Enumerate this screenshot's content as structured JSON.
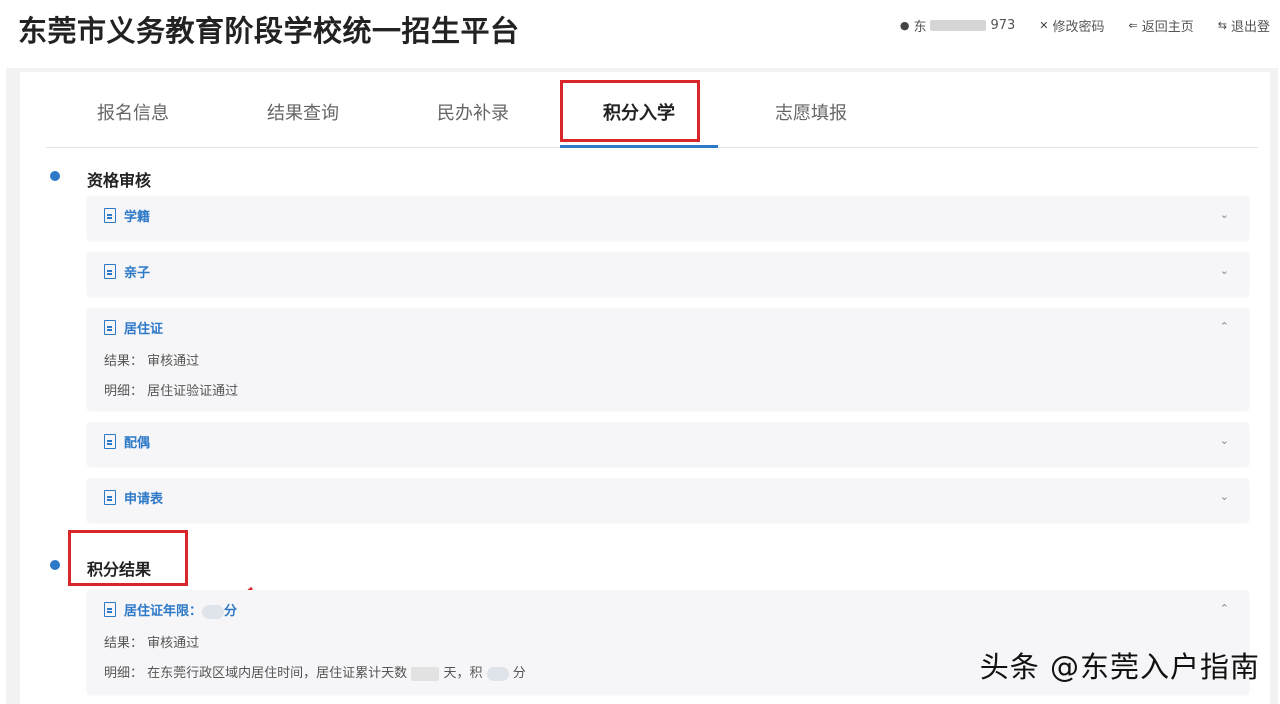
{
  "header": {
    "title": "东莞市义务教育阶段学校统一招生平台",
    "actions": [
      {
        "label": "东",
        "masked_suffix": "973",
        "icon": "user-icon"
      },
      {
        "label": "修改密码",
        "icon": "close-icon"
      },
      {
        "label": "返回主页",
        "icon": "back-icon"
      },
      {
        "label": "退出登",
        "icon": "logout-icon"
      }
    ]
  },
  "tabs": [
    {
      "label": "报名信息"
    },
    {
      "label": "结果查询"
    },
    {
      "label": "民办补录"
    },
    {
      "label": "积分入学",
      "active": true
    },
    {
      "label": "志愿填报"
    }
  ],
  "sections": {
    "qualification": {
      "title": "资格审核",
      "items": [
        {
          "name": "学籍",
          "chevron": "⌄"
        },
        {
          "name": "亲子",
          "chevron": "⌄"
        },
        {
          "name": "居住证",
          "chevron": "⌃",
          "result_label": "结果：",
          "result_value": "审核通过",
          "detail_label": "明细：",
          "detail_value": "居住证验证通过"
        },
        {
          "name": "配偶",
          "chevron": "⌄"
        },
        {
          "name": "申请表",
          "chevron": "⌄"
        }
      ]
    },
    "points_result": {
      "title": "积分结果",
      "items": [
        {
          "name": "居住证年限：",
          "name_suffix": "分",
          "chevron": "⌃",
          "result_label": "结果：",
          "result_value": "审核通过",
          "detail_label": "明细：",
          "detail_value_a": "在东莞行政区域内居住时间，居住证累计天数",
          "detail_value_b": "天，积",
          "detail_value_c": "分"
        }
      ]
    }
  },
  "watermark": "头条 @东莞入户指南",
  "colors": {
    "accent": "#2d79c7",
    "highlight_box": "#d9262b"
  }
}
